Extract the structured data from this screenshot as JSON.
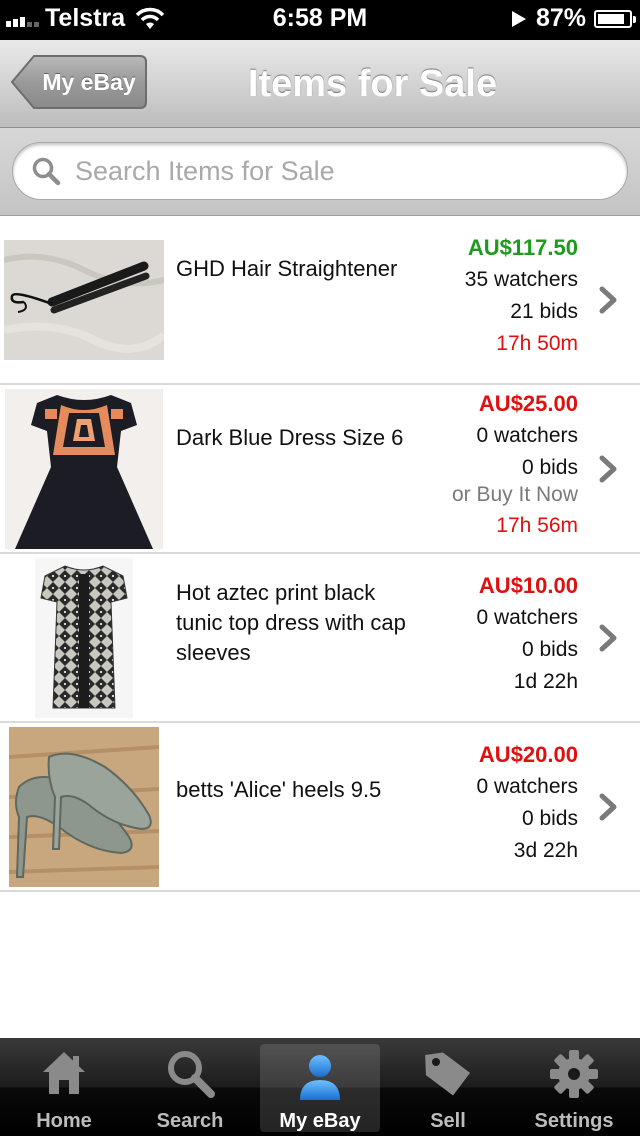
{
  "status_bar": {
    "carrier": "Telstra",
    "time": "6:58 PM",
    "battery": "87%",
    "battery_level": 0.87
  },
  "navbar": {
    "back_label": "My eBay",
    "title": "Items for Sale"
  },
  "search": {
    "placeholder": "Search Items for Sale"
  },
  "items": [
    {
      "title": "GHD Hair Straightener",
      "price": "AU$117.50",
      "price_color": "#1e9b1e",
      "watchers": "35 watchers",
      "bids": "21 bids",
      "buy_it_now": "",
      "time_left": "17h 50m",
      "time_color": "#e01010"
    },
    {
      "title": "Dark Blue Dress Size 6",
      "price": "AU$25.00",
      "price_color": "#e01010",
      "watchers": "0 watchers",
      "bids": "0 bids",
      "buy_it_now": "or Buy It Now",
      "time_left": "17h 56m",
      "time_color": "#e01010"
    },
    {
      "title": "Hot aztec print black tunic top dress with cap sleeves",
      "price": "AU$10.00",
      "price_color": "#e01010",
      "watchers": "0 watchers",
      "bids": "0 bids",
      "buy_it_now": "",
      "time_left": "1d 22h",
      "time_color": "#111111"
    },
    {
      "title": "betts 'Alice' heels 9.5",
      "price": "AU$20.00",
      "price_color": "#e01010",
      "watchers": "0 watchers",
      "bids": "0 bids",
      "buy_it_now": "",
      "time_left": "3d 22h",
      "time_color": "#111111"
    }
  ],
  "tabs": [
    {
      "label": "Home",
      "icon": "home-icon",
      "active": false
    },
    {
      "label": "Search",
      "icon": "search-icon",
      "active": false
    },
    {
      "label": "My eBay",
      "icon": "person-icon",
      "active": true
    },
    {
      "label": "Sell",
      "icon": "tag-icon",
      "active": false
    },
    {
      "label": "Settings",
      "icon": "gear-icon",
      "active": false
    }
  ],
  "colors": {
    "price_green": "#1e9b1e",
    "price_red": "#e01010",
    "active_tab_icon": "#2f8ee0"
  }
}
